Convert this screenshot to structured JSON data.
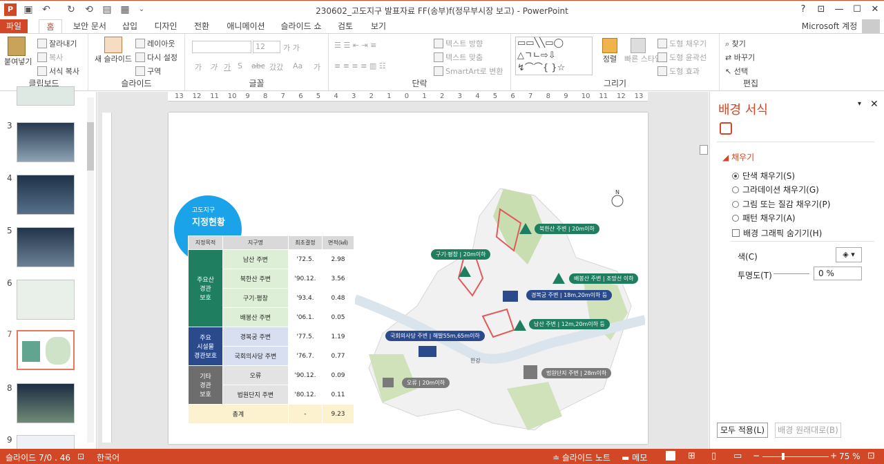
{
  "window": {
    "title": "230602_고도지구 발표자료 FF(송부)f(정무부시장 보고) - PowerPoint",
    "help": "?",
    "account": "Microsoft 계정",
    "controls": {
      "ribbon_opts": "⊡",
      "minimize": "—",
      "maximize": "☐",
      "close": "✕"
    }
  },
  "quick_access": {
    "app_icon": "P",
    "save": "💾",
    "undo": "↶",
    "redo": "↻",
    "more": "⌄"
  },
  "tabs": [
    "파일",
    "홈",
    "보안 문서",
    "삽입",
    "디자인",
    "전환",
    "애니메이션",
    "슬라이드 쇼",
    "검토",
    "보기"
  ],
  "ribbon": {
    "clipboard": {
      "label": "클립보드",
      "paste": "붙여넣기",
      "cut": "잘라내기",
      "copy": "복사",
      "format_painter": "서식 복사"
    },
    "slides": {
      "label": "슬라이드",
      "new_slide": "새 슬라이드",
      "layout": "레이아웃",
      "reset": "다시 설정",
      "section": "구역"
    },
    "font": {
      "label": "글꼴",
      "size": "12",
      "bold": "가",
      "italic": "가",
      "underline": "가",
      "strike": "S",
      "abc": "abc",
      "spacing": "갔갔",
      "case": "Aa",
      "color": "가"
    },
    "paragraph": {
      "label": "단락",
      "text_dir": "텍스트 방향",
      "align_text": "텍스트 맞춤",
      "smartart": "SmartArt로 변환"
    },
    "drawing": {
      "label": "그리기",
      "arrange": "정렬",
      "quick_styles": "빠른 스타일",
      "shape_fill": "도형 채우기",
      "shape_outline": "도형 윤곽선",
      "shape_effects": "도형 효과"
    },
    "editing": {
      "label": "편집",
      "find": "찾기",
      "replace": "바꾸기",
      "select": "선택"
    }
  },
  "thumbs": [
    {
      "n": "3"
    },
    {
      "n": "4"
    },
    {
      "n": "5"
    },
    {
      "n": "6"
    },
    {
      "n": "7"
    },
    {
      "n": "8"
    },
    {
      "n": "9"
    }
  ],
  "ruler_labels": [
    "13",
    "12",
    "11",
    "10",
    "9",
    "8",
    "7",
    "6",
    "5",
    "4",
    "3",
    "2",
    "1",
    "0",
    "1",
    "2",
    "3",
    "4",
    "5",
    "6",
    "7",
    "8",
    "9",
    "10",
    "11",
    "12",
    "13"
  ],
  "slide": {
    "badge": {
      "line1": "고도지구",
      "line2": "지정현황"
    },
    "table": {
      "headers": [
        "지정목적",
        "지구명",
        "최초결정",
        "면적(㎢)"
      ],
      "rows": [
        {
          "name": "남산 주변",
          "date": "'72.5.",
          "area": "2.98"
        },
        {
          "name": "북한산 주변",
          "date": "'90.12.",
          "area": "3.56"
        },
        {
          "name": "구기·평창",
          "date": "'93.4.",
          "area": "0.48"
        },
        {
          "name": "배봉산 주변",
          "date": "'06.1.",
          "area": "0.05"
        },
        {
          "name": "경복궁 주변",
          "date": "'77.5.",
          "area": "1.19"
        },
        {
          "name": "국회의사당 주변",
          "date": "'76.7.",
          "area": "0.77"
        },
        {
          "name": "오류",
          "date": "'90.12.",
          "area": "0.09"
        },
        {
          "name": "법원단지 주변",
          "date": "'80.12.",
          "area": "0.11"
        }
      ],
      "cats": [
        "주요산\n경관\n보호",
        "주요\n시설물\n경관보호",
        "기타\n경관\n보호"
      ],
      "total": {
        "label": "총계",
        "date": "-",
        "area": "9.23"
      }
    },
    "map": {
      "north": "N",
      "river": "한강",
      "labels": [
        {
          "text": "북한산 주변 | 20m이하"
        },
        {
          "text": "구기·평창 | 20m이하"
        },
        {
          "text": "배봉산 주변 | 조망선 이하"
        },
        {
          "text": "경복궁 주변 | 18m,20m이하 등"
        },
        {
          "text": "남산 주변 | 12m,20m이하 등"
        },
        {
          "text": "국회의사당 주변 | 해발55m,65m이하"
        },
        {
          "text": "오류 | 20m이하"
        },
        {
          "text": "법원단지 주변 | 28m이하"
        }
      ]
    }
  },
  "pane": {
    "title": "배경 서식",
    "section": "채우기",
    "options": [
      "단색 채우기(S)",
      "그라데이션 채우기(G)",
      "그림 또는 질감 채우기(P)",
      "패턴 채우기(A)"
    ],
    "hide_bg": "배경 그래픽 숨기기(H)",
    "color_label": "색(C)",
    "transparency_label": "투명도(T)",
    "transparency_value": "0 %",
    "apply_all": "모두 적용(L)",
    "reset_bg": "배경 원래대로(B)"
  },
  "status": {
    "slide": "슬라이드 7/0 . 46",
    "lang": "한국어",
    "notes": "슬라이드 노트",
    "comments": "메모",
    "zoom": "75 %"
  }
}
